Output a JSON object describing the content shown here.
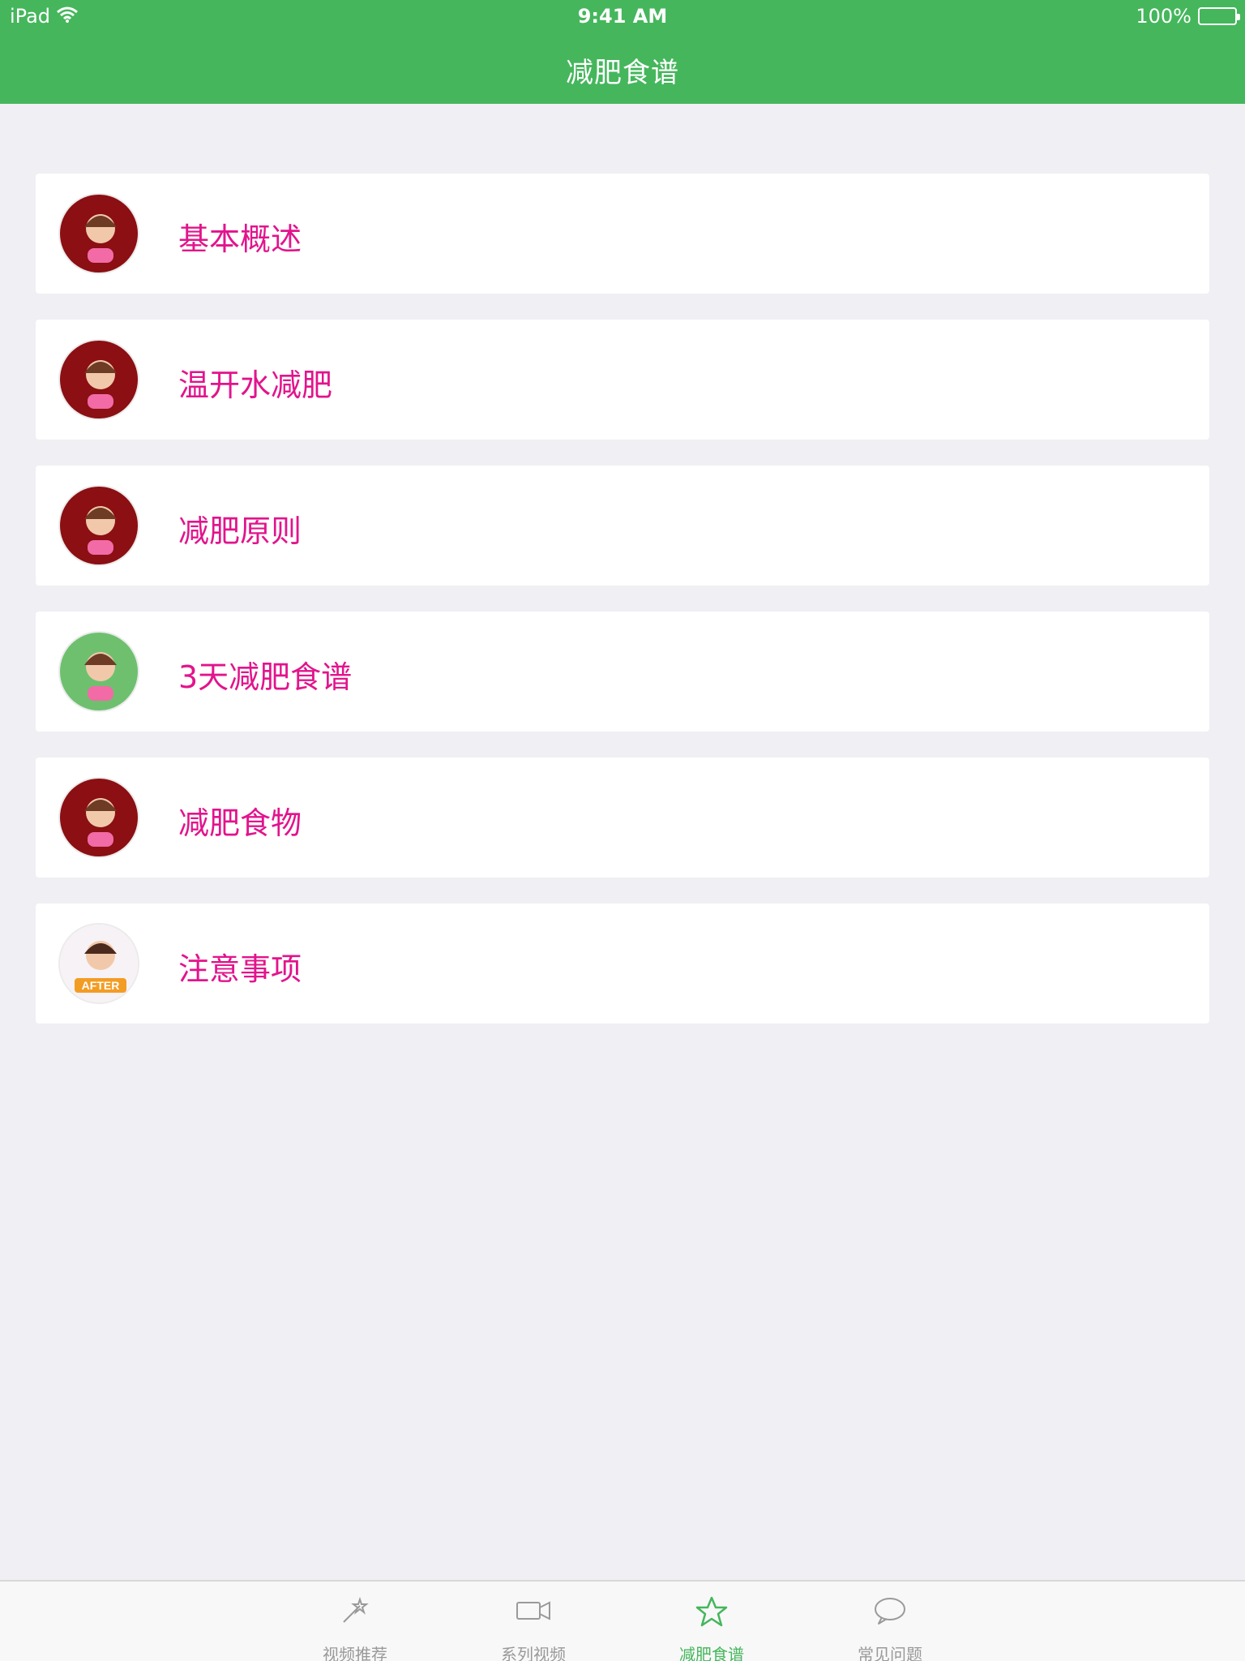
{
  "status_bar": {
    "device": "iPad",
    "time": "9:41 AM",
    "battery": "100%"
  },
  "nav": {
    "title": "减肥食谱"
  },
  "items": [
    {
      "label": "基本概述",
      "avatar": {
        "bg": "#8b0f13",
        "accent": "#f26aa6"
      }
    },
    {
      "label": "温开水减肥",
      "avatar": {
        "bg": "#8b0f13",
        "accent": "#f26aa6"
      }
    },
    {
      "label": "减肥原则",
      "avatar": {
        "bg": "#8b0f13",
        "accent": "#f26aa6"
      }
    },
    {
      "label": "3天减肥食谱",
      "avatar": {
        "bg": "#6ec06f",
        "accent": "#f26aa6"
      }
    },
    {
      "label": "减肥食物",
      "avatar": {
        "bg": "#8b0f13",
        "accent": "#f26aa6"
      }
    },
    {
      "label": "注意事项",
      "avatar": {
        "bg": "#f7f2f5",
        "accent": "#f39c24"
      },
      "avatar_text": "AFTER"
    }
  ],
  "tabbar": {
    "tabs": [
      {
        "label": "视频推荐",
        "icon": "magic-wand-icon"
      },
      {
        "label": "系列视频",
        "icon": "video-camera-icon"
      },
      {
        "label": "减肥食谱",
        "icon": "star-icon",
        "active": true
      },
      {
        "label": "常见问题",
        "icon": "chat-bubble-icon"
      }
    ]
  },
  "colors": {
    "nav_green": "#45b65c",
    "label_pink": "#e2148c",
    "background": "#efeff4"
  }
}
